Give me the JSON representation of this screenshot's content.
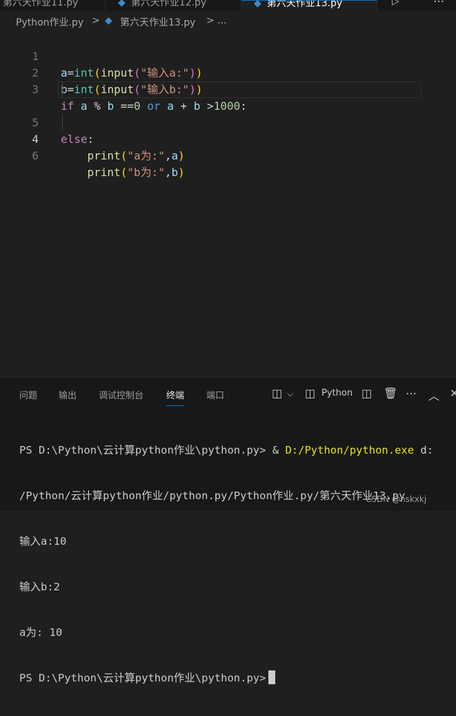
{
  "tabs": [
    {
      "label": "第六天作业11.py",
      "active": false
    },
    {
      "label": "第六天作业12.py",
      "active": false
    },
    {
      "label": "第六天作业13.py",
      "active": true
    }
  ],
  "breadcrumb": {
    "folder": "Python作业.py",
    "sep": ">",
    "file": "第六天作业13.py",
    "rest": "> ..."
  },
  "code": {
    "line_numbers": [
      "1",
      "2",
      "3",
      "4",
      "5",
      "6"
    ],
    "current_line": 4
  },
  "panel": {
    "tabs": [
      "问题",
      "输出",
      "调试控制台",
      "终端",
      "端口"
    ],
    "active_tab": "终端",
    "shell_label": "Python"
  },
  "terminal": {
    "lines": [
      "PS D:\\Python\\云计算python作业\\python.py> & ",
      "/Python/云计算python作业/python.py/Python作业.py/第六天作业13.py",
      "输入a:10",
      "输入b:2",
      "a为: 10",
      "PS D:\\Python\\云计算python作业\\python.py>"
    ],
    "exe": "D:/Python/python.exe",
    "line1_tail": " d:"
  },
  "watermark": "CSDN @hskxkj"
}
